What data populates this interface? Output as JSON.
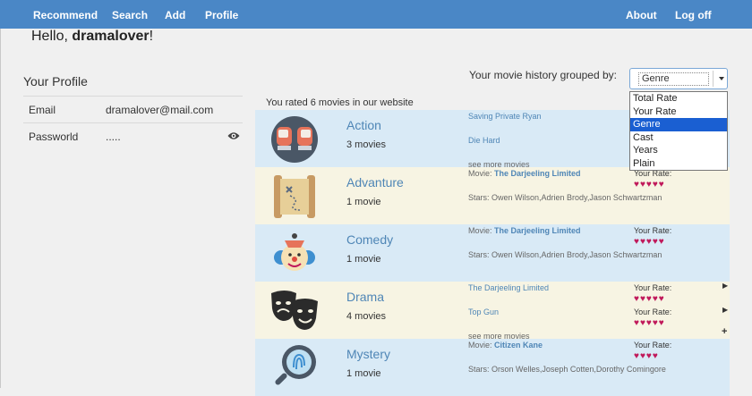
{
  "nav": {
    "left": [
      "Recommend",
      "Search",
      "Add",
      "Profile"
    ],
    "right": [
      "About",
      "Log off"
    ]
  },
  "greeting": {
    "prefix": "Hello, ",
    "username": "dramalover",
    "suffix": "!"
  },
  "profile": {
    "title": "Your Profile",
    "email_label": "Email",
    "email_value": "dramalover@mail.com",
    "password_label": "Passworld",
    "password_value": "....."
  },
  "history": {
    "label": "Your movie history grouped by:",
    "selected": "Genre",
    "options": [
      "Total Rate",
      "Your Rate",
      "Genre",
      "Cast",
      "Years",
      "Plain"
    ]
  },
  "rated_note": "You rated 6 movies in our website",
  "accent_color": "#4a87c6",
  "heart_color": "#c0185a",
  "groups": [
    {
      "name": "Action",
      "count": "3 movies",
      "icon": "boxing-gloves-icon",
      "movies": [
        "Saving Private Ryan",
        "Die Hard"
      ],
      "see_more": "see more movies"
    },
    {
      "name": "Advanture",
      "count": "1 movie",
      "icon": "treasure-map-icon",
      "movie_prefix": "Movie: ",
      "movie_title": "The Darjeeling Limited",
      "stars": "Stars: Owen Wilson,Adrien Brody,Jason Schwartzman",
      "rate_label": "Your Rate:",
      "rating": 5
    },
    {
      "name": "Comedy",
      "count": "1 movie",
      "icon": "clown-icon",
      "movie_prefix": "Movie: ",
      "movie_title": "The Darjeeling Limited",
      "stars": "Stars: Owen Wilson,Adrien Brody,Jason Schwartzman",
      "rate_label": "Your Rate:",
      "rating": 5
    },
    {
      "name": "Drama",
      "count": "4 movies",
      "icon": "theater-masks-icon",
      "movies": [
        "The Darjeeling Limited",
        "Top Gun"
      ],
      "rate_label": "Your Rate:",
      "ratings": [
        5,
        5
      ],
      "see_more": "see more movies"
    },
    {
      "name": "Mystery",
      "count": "1 movie",
      "icon": "magnifier-fingerprint-icon",
      "movie_prefix": "Movie: ",
      "movie_title": "Citizen Kane",
      "stars": "Stars: Orson Welles,Joseph Cotten,Dorothy Comingore",
      "rate_label": "Your Rate:",
      "rating": 4
    }
  ]
}
